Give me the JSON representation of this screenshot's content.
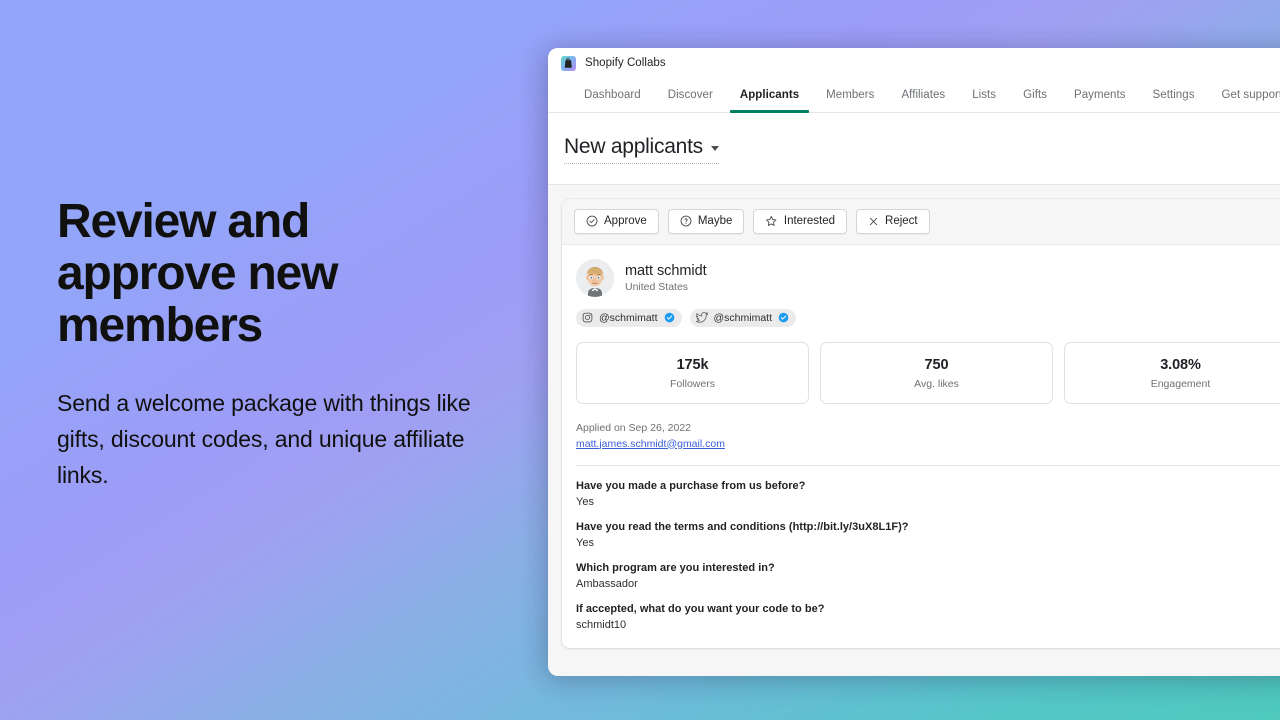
{
  "promo": {
    "heading": "Review and approve new members",
    "subheading": "Send a welcome package with things like gifts, discount codes, and unique affiliate links."
  },
  "window": {
    "titlebar": {
      "app_name": "Shopify Collabs",
      "icon": "shopify-bag-icon"
    },
    "nav": {
      "tabs": [
        {
          "label": "Dashboard",
          "active": false
        },
        {
          "label": "Discover",
          "active": false
        },
        {
          "label": "Applicants",
          "active": true
        },
        {
          "label": "Members",
          "active": false
        },
        {
          "label": "Affiliates",
          "active": false
        },
        {
          "label": "Lists",
          "active": false
        },
        {
          "label": "Gifts",
          "active": false
        },
        {
          "label": "Payments",
          "active": false
        },
        {
          "label": "Settings",
          "active": false
        },
        {
          "label": "Get support",
          "active": false
        }
      ],
      "active_color": "#008060"
    },
    "page": {
      "title": "New applicants",
      "dropdown_icon": "chevron-down-icon"
    },
    "toolbar": {
      "buttons": [
        {
          "label": "Approve",
          "icon": "check-circle-icon"
        },
        {
          "label": "Maybe",
          "icon": "question-circle-icon"
        },
        {
          "label": "Interested",
          "icon": "star-icon"
        },
        {
          "label": "Reject",
          "icon": "x-icon"
        }
      ]
    },
    "applicant": {
      "name": "matt schmidt",
      "location": "United States",
      "avatar": "user-avatar",
      "socials": [
        {
          "platform": "instagram-icon",
          "handle": "@schmimatt",
          "verified": true
        },
        {
          "platform": "twitter-icon",
          "handle": "@schmimatt",
          "verified": true
        }
      ],
      "stats": [
        {
          "value": "175k",
          "label": "Followers"
        },
        {
          "value": "750",
          "label": "Avg. likes"
        },
        {
          "value": "3.08%",
          "label": "Engagement"
        }
      ],
      "applied_on": "Applied on Sep 26, 2022",
      "email": "matt.james.schmidt@gmail.com",
      "questions": [
        {
          "question": "Have you made a purchase from us before?",
          "answer": "Yes"
        },
        {
          "question": "Have you read the terms and conditions (http://bit.ly/3uX8L1F)?",
          "answer": "Yes"
        },
        {
          "question": "Which program are you interested in?",
          "answer": "Ambassador"
        },
        {
          "question": "If accepted, what do you want your code to be?",
          "answer": "schmidt10"
        }
      ]
    }
  }
}
